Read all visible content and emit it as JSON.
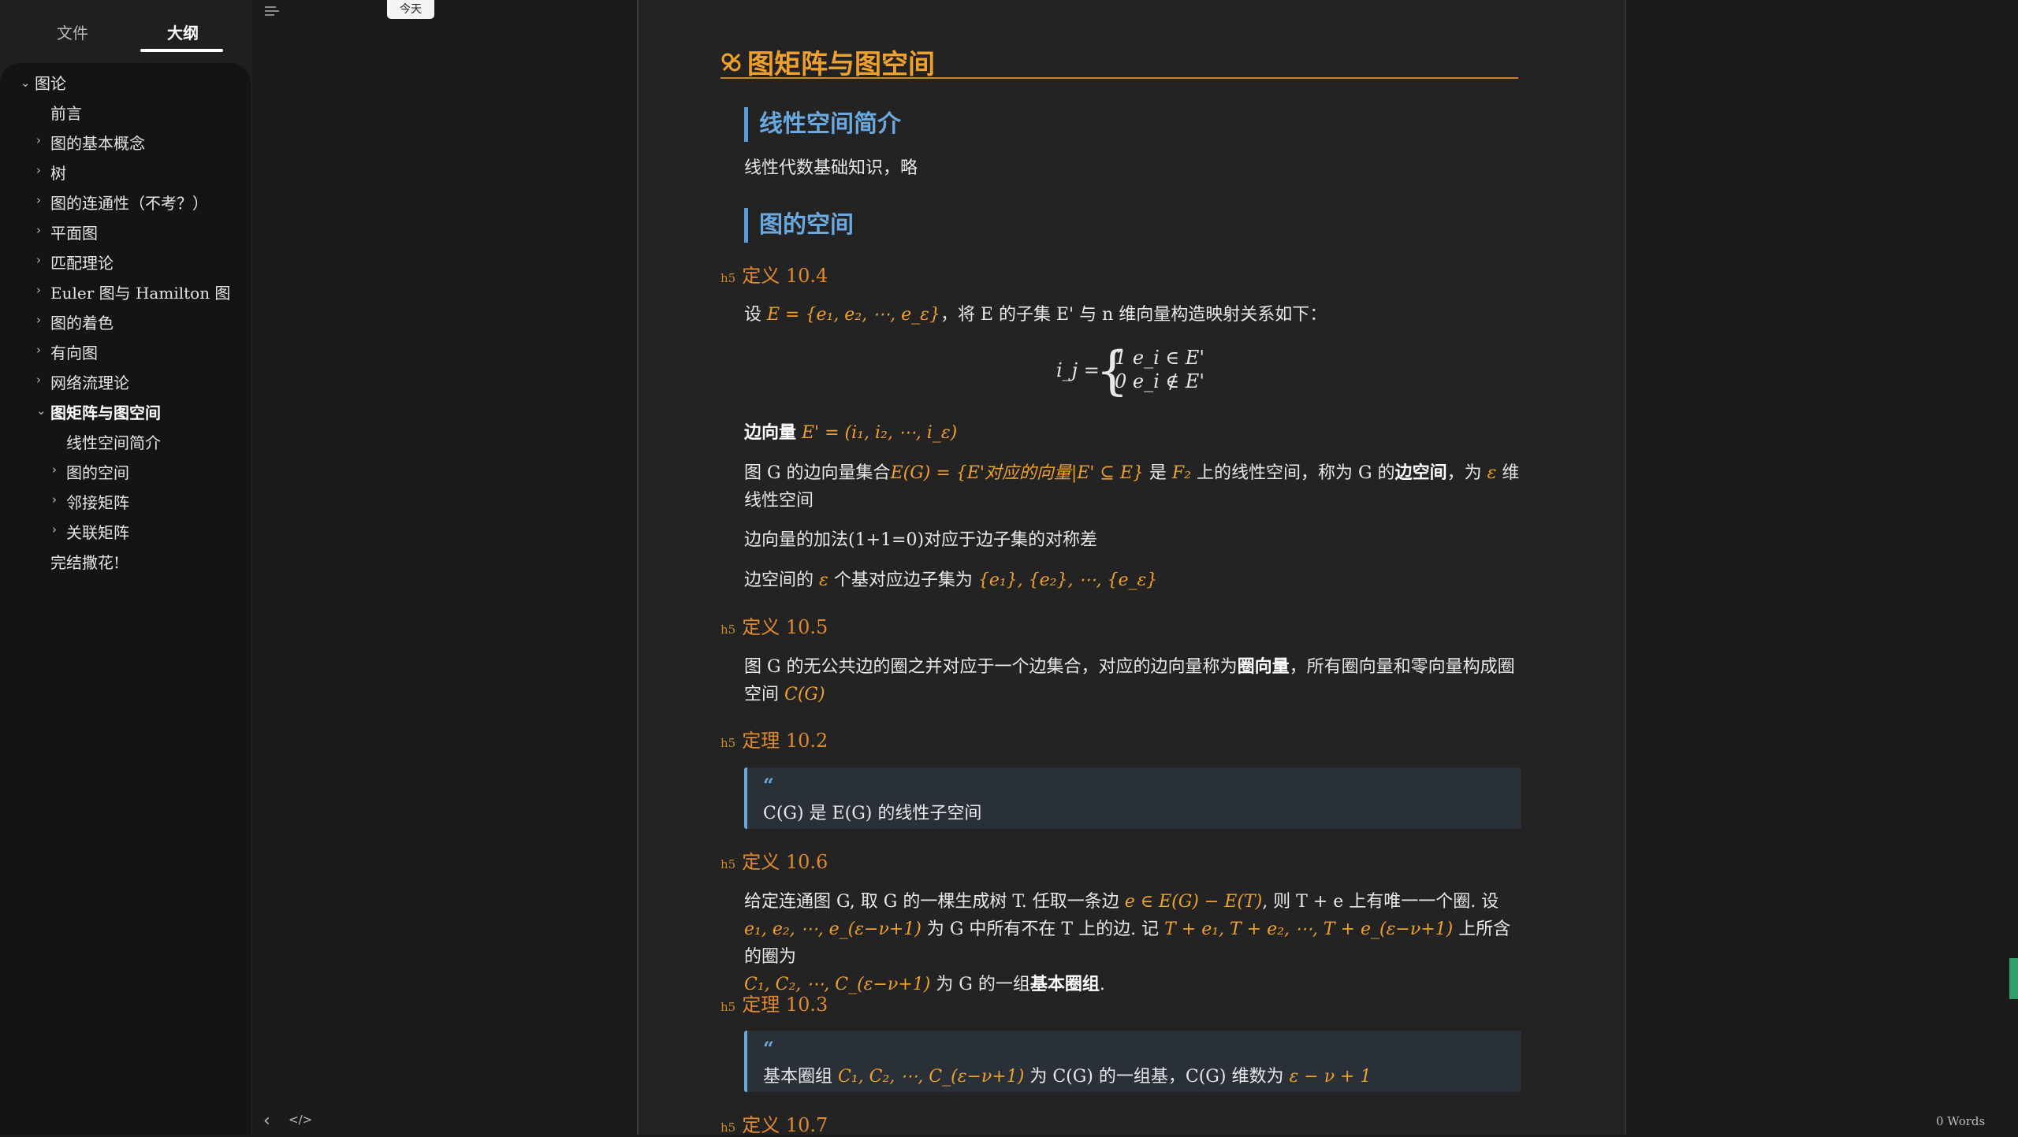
{
  "sidebar": {
    "tabs": [
      {
        "label": "文件"
      },
      {
        "label": "大纲"
      }
    ],
    "outline": [
      {
        "label": "图论",
        "level": 0
      },
      {
        "label": "前言",
        "level": 1
      },
      {
        "label": "图的基本概念",
        "level": 1
      },
      {
        "label": "树",
        "level": 1
      },
      {
        "label": "图的连通性（不考？）",
        "level": 1
      },
      {
        "label": "平面图",
        "level": 1
      },
      {
        "label": "匹配理论",
        "level": 1
      },
      {
        "label": "Euler 图与 Hamilton 图",
        "level": 1
      },
      {
        "label": "图的着色",
        "level": 1
      },
      {
        "label": "有向图",
        "level": 1
      },
      {
        "label": "网络流理论",
        "level": 1
      },
      {
        "label": "图矩阵与图空间",
        "level": 1,
        "active": true
      },
      {
        "label": "线性空间简介",
        "level": 2
      },
      {
        "label": "图的空间",
        "level": 2
      },
      {
        "label": "邻接矩阵",
        "level": 2
      },
      {
        "label": "关联矩阵",
        "level": 2
      },
      {
        "label": "完结撒花!",
        "level": 1
      }
    ]
  },
  "toolbar": {
    "today": "今天"
  },
  "footer": {
    "back": "‹",
    "source": "</>",
    "word_count": "0 Words"
  },
  "doc": {
    "h1": "图矩阵与图空间",
    "h3_a": "线性空间简介",
    "p_a": "线性代数基础知识，略",
    "h3_b": "图的空间",
    "h5_tag": "h5",
    "def104": "定义 10.4",
    "p_def104_pre": "设 ",
    "p_def104_math": "E = {e₁, e₂, ⋯, e_ε}",
    "p_def104_post": "，将 E 的子集 E' 与 n 维向量构造映射关系如下：",
    "eq_lhs": "i_j =",
    "eq_row1": "1    e_i ∈ E'",
    "eq_row2": "0    e_i ∉ E'",
    "p_edgevec_label": "边向量",
    "p_edgevec_math": "E' = (i₁, i₂, ⋯, i_ε)",
    "p_space_1": "图 G 的边向量集合",
    "p_space_math1": "E(G) = {E'对应的向量|E' ⊆ E}",
    "p_space_2": "是",
    "p_space_math2": "F₂",
    "p_space_3": "上的线性空间，称为 G 的",
    "p_space_bold": "边空间",
    "p_space_4": "，为",
    "p_space_math3": "ε",
    "p_space_5": "维线性空间",
    "p_add": "边向量的加法(1+1=0)对应于边子集的对称差",
    "p_basis_1": "边空间的",
    "p_basis_math1": "ε",
    "p_basis_2": "个基对应边子集为",
    "p_basis_math2": "{e₁}, {e₂}, ⋯, {e_ε}",
    "def105": "定义 10.5",
    "p_def105_1": "图 G 的无公共边的圈之并对应于一个边集合，对应的边向量称为",
    "p_def105_bold": "圈向量",
    "p_def105_2": "，所有圈向量和零向量构成圈空间",
    "p_def105_math": "C(G)",
    "thm102": "定理 10.2",
    "quote1": "C(G) 是 E(G) 的线性子空间",
    "def106": "定义 10.6",
    "p_def106_1": "给定连通图 G, 取 G 的一棵生成树 T.  任取一条边",
    "p_def106_m1": "e ∈ E(G) − E(T)",
    "p_def106_2": ", 则 T + e 上有唯一一个圈. 设",
    "p_def106_m2": "e₁, e₂, ⋯, e_(ε−ν+1)",
    "p_def106_3": "为 G 中所有不在 T 上的边. 记",
    "p_def106_m3": "T + e₁, T + e₂, ⋯, T + e_(ε−ν+1)",
    "p_def106_4": "上所含的圈为",
    "p_def106_m4": "C₁, C₂, ⋯, C_(ε−ν+1)",
    "p_def106_5": "为 G 的一组",
    "p_def106_bold": "基本圈组",
    "p_def106_6": ".",
    "thm103": "定理 10.3",
    "quote2_1": "基本圈组",
    "quote2_m1": "C₁, C₂, ⋯, C_(ε−ν+1)",
    "quote2_2": "为 C(G) 的一组基，C(G) 维数为",
    "quote2_m2": "ε − ν + 1",
    "def107": "定义 10.7",
    "quote_mark": "“"
  },
  "colors": {
    "heading": "#f0a12c",
    "h3": "#6aa8e0",
    "math": "#f0a12c",
    "quote_bg": "#2a3038",
    "scroll_indicator": "#2fa06a"
  }
}
